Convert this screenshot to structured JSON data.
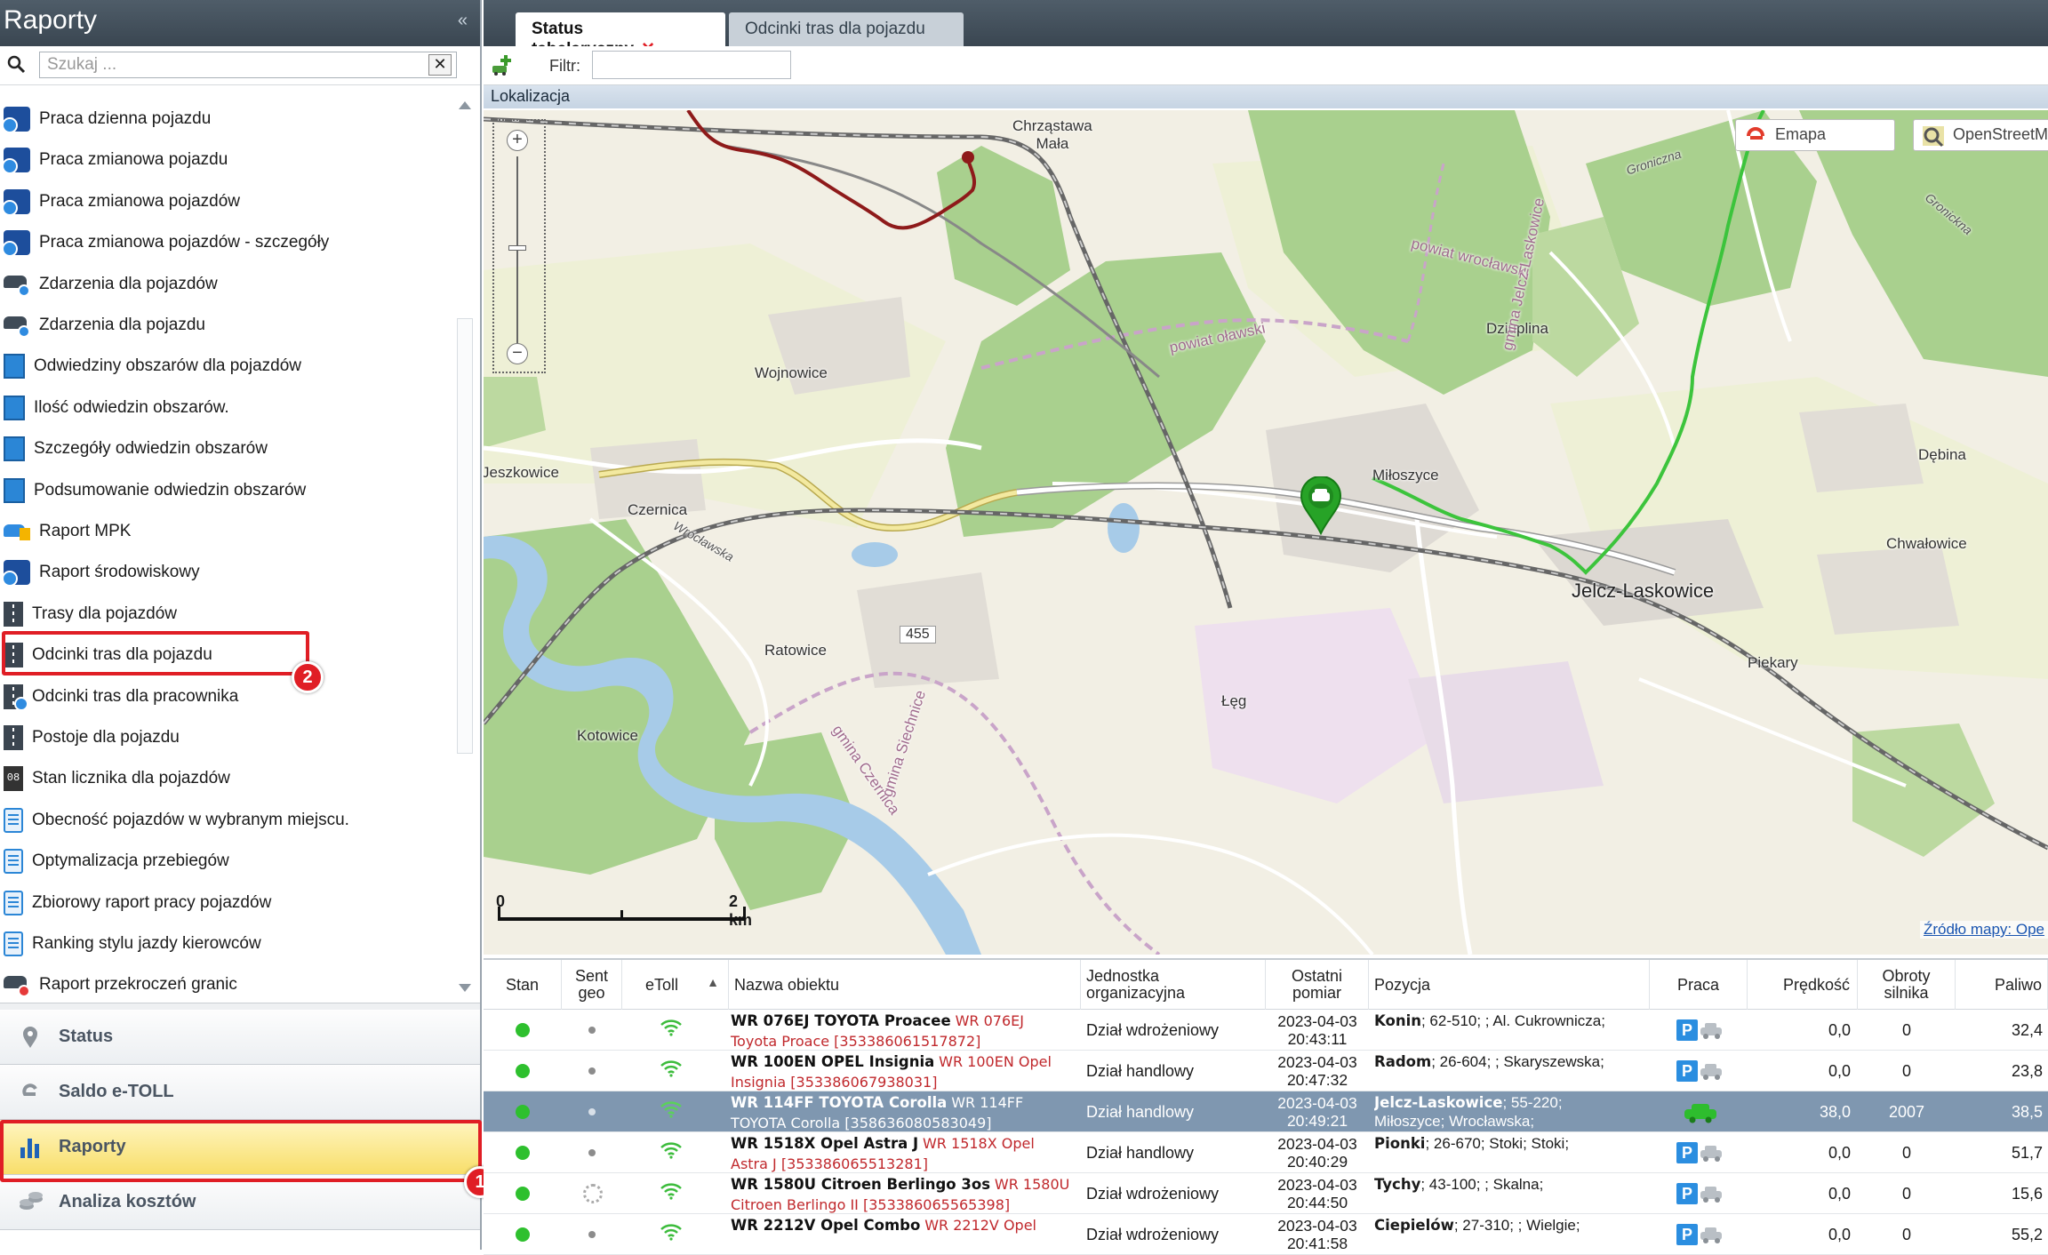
{
  "left": {
    "title": "Raporty",
    "collapse_glyph": "«",
    "search_placeholder": "Szukaj ...",
    "clear_glyph": "✕"
  },
  "reports": [
    {
      "label": "Praca dzienna pojazdu",
      "icon": "clock"
    },
    {
      "label": "Praca zmianowa pojazdu",
      "icon": "clock"
    },
    {
      "label": "Praca zmianowa pojazdów",
      "icon": "clock"
    },
    {
      "label": "Praca zmianowa pojazdów - szczegóły",
      "icon": "clock"
    },
    {
      "label": "Zdarzenia dla pojazdów",
      "icon": "car"
    },
    {
      "label": "Zdarzenia dla pojazdu",
      "icon": "car"
    },
    {
      "label": "Odwiedziny obszarów dla pojazdów",
      "icon": "area"
    },
    {
      "label": "Ilość odwiedzin obszarów.",
      "icon": "area"
    },
    {
      "label": "Szczegóły odwiedzin obszarów",
      "icon": "area"
    },
    {
      "label": "Podsumowanie odwiedzin obszarów",
      "icon": "area"
    },
    {
      "label": "Raport MPK",
      "icon": "mpk"
    },
    {
      "label": "Raport środowiskowy",
      "icon": "clock"
    },
    {
      "label": "Trasy dla pojazdów",
      "icon": "road"
    },
    {
      "label": "Odcinki tras dla pojazdu",
      "icon": "road"
    },
    {
      "label": "Odcinki tras dla pracownika",
      "icon": "road-blue"
    },
    {
      "label": "Postoje dla pojazdu",
      "icon": "road"
    },
    {
      "label": "Stan licznika dla pojazdów",
      "icon": "counter"
    },
    {
      "label": "Obecność pojazdów w wybranym miejscu.",
      "icon": "doc"
    },
    {
      "label": "Optymalizacja przebiegów",
      "icon": "doc"
    },
    {
      "label": "Zbiorowy raport pracy pojazdów",
      "icon": "doc"
    },
    {
      "label": "Ranking stylu jazdy kierowców",
      "icon": "doc"
    },
    {
      "label": "Raport przekroczeń granic",
      "icon": "car-red"
    }
  ],
  "annotations": {
    "badge1": "1",
    "badge2": "2"
  },
  "nav": [
    {
      "label": "Status",
      "icon": "pin-icon",
      "active": false
    },
    {
      "label": "Saldo e-TOLL",
      "icon": "etoll-icon",
      "active": false
    },
    {
      "label": "Raporty",
      "icon": "bar-chart-icon",
      "active": true
    },
    {
      "label": "Analiza kosztów",
      "icon": "coins-icon",
      "active": false
    }
  ],
  "tabs": {
    "active": "Status tabelaryczny",
    "active_close": "✕",
    "inactive": "Odcinki tras dla pojazdu"
  },
  "toolbar": {
    "filter_label": "Filtr:",
    "filter_value": ""
  },
  "location_header": "Lokalizacja",
  "map": {
    "layer_emapa": "Emapa",
    "layer_osm": "OpenStreetMap",
    "attribution": "Źródło mapy: Ope",
    "scale_start": "0",
    "scale_end": "2 km",
    "zoom_in": "+",
    "zoom_out": "−",
    "road_number": "455",
    "places": [
      {
        "name": "Chrząstawa\nMała",
        "kind": "town"
      },
      {
        "name": "Wojnowice",
        "kind": "town"
      },
      {
        "name": "Jeszkowice",
        "kind": "town"
      },
      {
        "name": "Czernica",
        "kind": "town"
      },
      {
        "name": "Dziuplina",
        "kind": "town"
      },
      {
        "name": "Miłoszyce",
        "kind": "town"
      },
      {
        "name": "Dębina",
        "kind": "town"
      },
      {
        "name": "Chwałowice",
        "kind": "town"
      },
      {
        "name": "Jelcz-Laskowice",
        "kind": "city"
      },
      {
        "name": "Ratowice",
        "kind": "town"
      },
      {
        "name": "Piekary",
        "kind": "town"
      },
      {
        "name": "Łęg",
        "kind": "town"
      },
      {
        "name": "Kotowice",
        "kind": "town"
      },
      {
        "name": "powiat wrocławski",
        "kind": "district"
      },
      {
        "name": "powiat oławski",
        "kind": "district"
      },
      {
        "name": "gmina Czernica",
        "kind": "district"
      },
      {
        "name": "gmina Jelcz-Laskowice",
        "kind": "district"
      },
      {
        "name": "gmina Siechnice",
        "kind": "district"
      },
      {
        "name": "Wrocławska",
        "kind": "street"
      },
      {
        "name": "Groniczna",
        "kind": "street"
      },
      {
        "name": "Gronickna",
        "kind": "street"
      }
    ]
  },
  "table": {
    "headers": {
      "stan": "Stan",
      "sentgeo": "Sent\ngeo",
      "etoll": "eToll",
      "nazwa": "Nazwa obiektu",
      "jednostka": "Jednostka\norganizacyjna",
      "ostatni": "Ostatni\npomiar",
      "pozycja": "Pozycja",
      "praca": "Praca",
      "predkosc": "Prędkość",
      "obroty": "Obroty\nsilnika",
      "paliwo": "Paliwo"
    },
    "sort_glyph": "▲",
    "rows": [
      {
        "name_bold": "WR 076EJ TOYOTA Proacee",
        "name_red_1": "WR 076EJ",
        "name_red_2": "Toyota Proace [353386061517872]",
        "unit": "Dział wdrożeniowy",
        "date": "2023-04-03",
        "time": "20:43:11",
        "pos_bold": "Konin",
        "pos_rest": "; 62-510; ; Al. Cukrownicza;",
        "pos_line2": "",
        "speed": "0,0",
        "rpm": "0",
        "fuel": "32,4",
        "work": "parked",
        "selected": false
      },
      {
        "name_bold": "WR 100EN OPEL Insignia",
        "name_red_1": "WR 100EN Opel",
        "name_red_2": "Insignia [353386067938031]",
        "unit": "Dział handlowy",
        "date": "2023-04-03",
        "time": "20:47:32",
        "pos_bold": "Radom",
        "pos_rest": "; 26-604; ; Skaryszewska;",
        "pos_line2": "",
        "speed": "0,0",
        "rpm": "0",
        "fuel": "23,8",
        "work": "parked",
        "selected": false
      },
      {
        "name_bold": "WR 114FF TOYOTA Corolla",
        "name_red_1": "WR 114FF",
        "name_red_2": "TOYOTA Corolla [358636080583049]",
        "unit": "Dział handlowy",
        "date": "2023-04-03",
        "time": "20:49:21",
        "pos_bold": "Jelcz-Laskowice",
        "pos_rest": "; 55-220;",
        "pos_line2": "Miłoszyce; Wrocławska;",
        "speed": "38,0",
        "rpm": "2007",
        "fuel": "38,5",
        "work": "driving",
        "selected": true
      },
      {
        "name_bold": "WR 1518X Opel Astra J",
        "name_red_1": "WR 1518X Opel",
        "name_red_2": "Astra J [353386065513281]",
        "unit": "Dział handlowy",
        "date": "2023-04-03",
        "time": "20:40:29",
        "pos_bold": "Pionki",
        "pos_rest": "; 26-670; Stoki; Stoki;",
        "pos_line2": "",
        "speed": "0,0",
        "rpm": "0",
        "fuel": "51,7",
        "work": "parked",
        "selected": false
      },
      {
        "name_bold": "WR 1580U Citroen Berlingo 3os",
        "name_red_1": "WR 1580U",
        "name_red_2": "Citroen Berlingo II [353386065565398]",
        "unit": "Dział wdrożeniowy",
        "date": "2023-04-03",
        "time": "20:44:50",
        "pos_bold": "Tychy",
        "pos_rest": "; 43-100; ; Skalna;",
        "pos_line2": "",
        "speed": "0,0",
        "rpm": "0",
        "fuel": "15,6",
        "work": "parked",
        "selected": false
      },
      {
        "name_bold": "WR 2212V Opel Combo",
        "name_red_1": "WR 2212V Opel",
        "name_red_2": "",
        "unit": "Dział wdrożeniowy",
        "date": "2023-04-03",
        "time": "20:41:58",
        "pos_bold": "Ciepielów",
        "pos_rest": "; 27-310; ; Wielgie;",
        "pos_line2": "",
        "speed": "0,0",
        "rpm": "0",
        "fuel": "55,2",
        "work": "parked",
        "selected": false
      }
    ]
  },
  "colors": {
    "accent_red": "#e01e25",
    "status_green": "#2ec02e",
    "route_green": "#33c233",
    "route_red": "#8e1a1a",
    "selected_row": "#7f97b0",
    "highlight_nav": "#f8de6a"
  }
}
